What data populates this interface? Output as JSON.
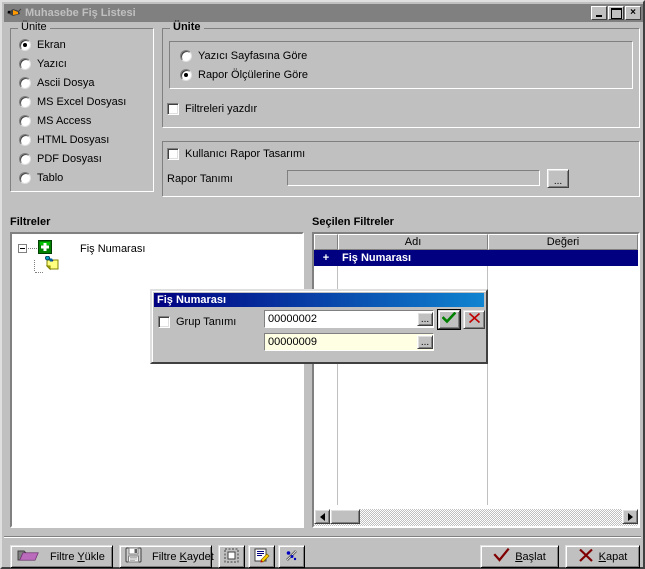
{
  "window": {
    "title": "Muhasebe Fiş Listesi",
    "icon": "document-report-icon",
    "minimize_label": "_",
    "maximize_label": "",
    "close_label": "×"
  },
  "unit_group_left": {
    "legend": "Ünite",
    "options": [
      {
        "label": "Ekran",
        "selected": true
      },
      {
        "label": "Yazıcı",
        "selected": false
      },
      {
        "label": "Ascii Dosya",
        "selected": false
      },
      {
        "label": "MS Excel Dosyası",
        "selected": false
      },
      {
        "label": "MS Access",
        "selected": false
      },
      {
        "label": "HTML Dosyası",
        "selected": false
      },
      {
        "label": "PDF Dosyası",
        "selected": false
      },
      {
        "label": "Tablo",
        "selected": false
      }
    ]
  },
  "unit_group_right": {
    "legend": "Ünite",
    "options": [
      {
        "label": "Yazıcı Sayfasına Göre",
        "selected": false
      },
      {
        "label": "Rapor Ölçülerine Göre",
        "selected": true
      }
    ],
    "print_filters": {
      "label": "Filtreleri yazdır",
      "checked": false
    },
    "user_report_design": {
      "label": "Kullanıcı Rapor Tasarımı",
      "checked": false
    },
    "report_definition": {
      "label": "Rapor Tanımı",
      "value": "",
      "placeholder": "",
      "browse_label": "...",
      "disabled": true
    }
  },
  "filters": {
    "title": "Filtreler",
    "tree": [
      {
        "label": "Fiş Numarası",
        "icon": "green-plus-icon",
        "expanded": true,
        "children": [
          {
            "label": "",
            "icon": "yellow-note-pin-icon"
          }
        ]
      }
    ]
  },
  "selected_filters": {
    "title": "Seçilen Filtreler",
    "columns": [
      "",
      "Adı",
      "Değeri"
    ],
    "rows": [
      {
        "indicator": "+",
        "name": "Fiş Numarası",
        "value": "",
        "selected": true
      }
    ],
    "scrollbar": {
      "left_arrow": "◀",
      "right_arrow": "▶"
    }
  },
  "modal": {
    "title": "Fiş Numarası",
    "group_definition": {
      "label": "Grup Tanımı",
      "checked": false
    },
    "value_from": {
      "value": "00000002",
      "browse_label": "...",
      "style": "white"
    },
    "value_to": {
      "value": "00000009",
      "browse_label": "...",
      "style": "cream"
    },
    "ok_icon": "green-check-icon",
    "cancel_icon": "red-x-icon"
  },
  "toolbar": {
    "load_filter": {
      "label_pre": "Filtre ",
      "accel": "Y",
      "label_post": "ükle",
      "icon": "open-folder-icon"
    },
    "save_filter": {
      "label_pre": "Filtre ",
      "accel": "K",
      "label_post": "aydet",
      "icon": "floppy-disk-icon"
    },
    "icon_buttons": [
      {
        "icon": "select-all-icon"
      },
      {
        "icon": "edit-document-icon"
      },
      {
        "icon": "wand-icon"
      }
    ],
    "start": {
      "label_pre": "",
      "accel": "B",
      "label_post": "aşlat",
      "icon": "check-mark-icon"
    },
    "close": {
      "label_pre": "",
      "accel": "K",
      "label_post": "apat",
      "icon": "x-mark-icon"
    }
  },
  "colors": {
    "face": "#c0c0c0",
    "selection": "#000080",
    "title_inactive": "#808080",
    "cream_field": "#ffffe4",
    "accent_dark_red": "#800000",
    "green": "#008000"
  }
}
